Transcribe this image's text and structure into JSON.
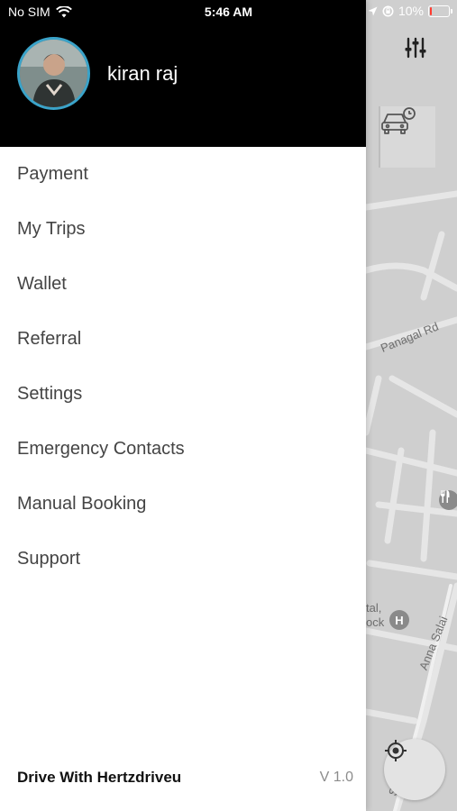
{
  "status_bar": {
    "carrier": "No SIM",
    "time": "5:46 AM",
    "battery_percent": "10%",
    "battery_level": 0.1,
    "battery_color": "#ff3b30"
  },
  "drawer": {
    "user_name": "kiran raj",
    "avatar_ring_color": "#3aa3c9",
    "menu": [
      {
        "label": "Payment"
      },
      {
        "label": "My Trips"
      },
      {
        "label": "Wallet"
      },
      {
        "label": "Referral"
      },
      {
        "label": "Settings"
      },
      {
        "label": "Emergency Contacts"
      },
      {
        "label": "Manual Booking"
      },
      {
        "label": "Support"
      }
    ],
    "footer": {
      "drive_link": "Drive With Hertzdriveu",
      "version": "V 1.0"
    }
  },
  "map": {
    "road_labels": {
      "panagal": "Panagal Rd",
      "anna": "Anna Salai",
      "tal": "tal,",
      "ock": "ock",
      "sa": "Sa"
    },
    "icons": {
      "filter": "sliders-icon",
      "ride": "car-clock-icon",
      "locate": "locate-icon",
      "restaurant": "fork-knife-icon",
      "hospital": "hospital-icon"
    }
  }
}
